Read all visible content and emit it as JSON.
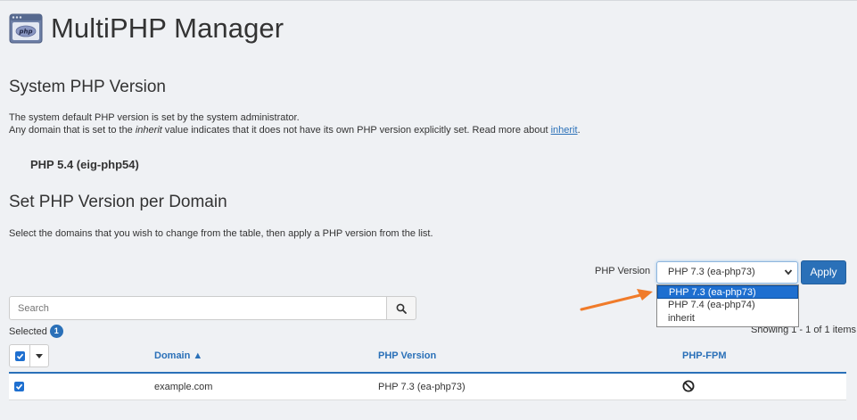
{
  "header": {
    "title": "MultiPHP Manager",
    "icon": "php-window-icon"
  },
  "system": {
    "heading": "System PHP Version",
    "line1": "The system default PHP version is set by the system administrator.",
    "line2_pre": "Any domain that is set to the ",
    "line2_em": "inherit",
    "line2_mid": " value indicates that it does not have its own PHP version explicitly set. Read more about ",
    "line2_link": "inherit",
    "line2_post": ".",
    "version": "PHP 5.4 (eig-php54)"
  },
  "per_domain": {
    "heading": "Set PHP Version per Domain",
    "description": "Select the domains that you wish to change from the table, then apply a PHP version from the list."
  },
  "controls": {
    "php_version_label": "PHP Version",
    "selected_value": "PHP 7.3 (ea-php73)",
    "options": [
      "PHP 7.3 (ea-php73)",
      "PHP 7.4 (ea-php74)",
      "inherit"
    ],
    "apply_label": "Apply"
  },
  "search": {
    "placeholder": "Search"
  },
  "selection": {
    "label": "Selected",
    "count": "1"
  },
  "pagination": {
    "showing": "Showing 1 - 1 of 1 items"
  },
  "table": {
    "columns": {
      "domain": "Domain ▲",
      "php_version": "PHP Version",
      "php_fpm": "PHP-FPM"
    },
    "rows": [
      {
        "domain": "example.com",
        "php_version": "PHP 7.3 (ea-php73)",
        "php_fpm": "disabled"
      }
    ]
  },
  "colors": {
    "accent": "#2a70b8",
    "arrow": "#f07b2a",
    "background": "#eff1f4"
  }
}
